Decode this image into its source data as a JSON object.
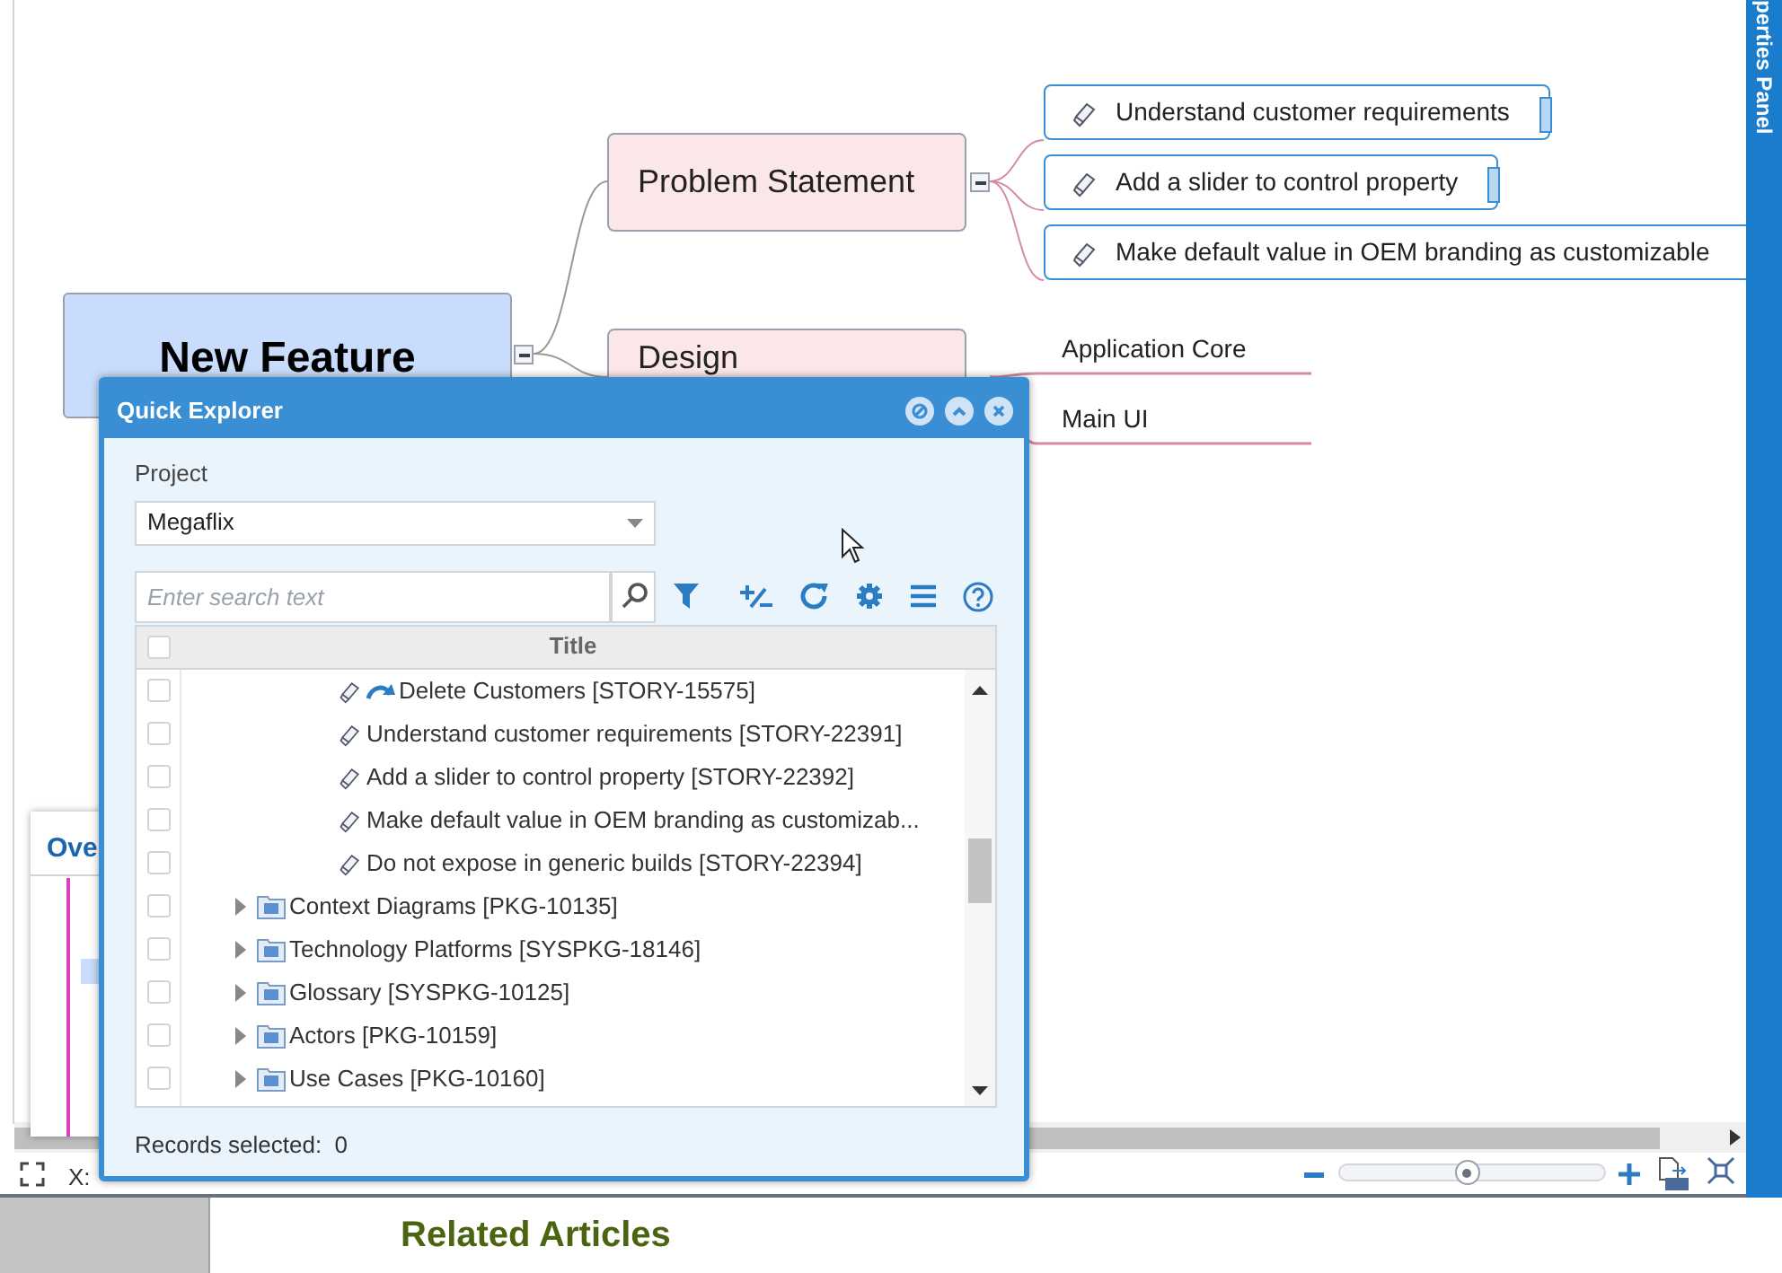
{
  "mind_map": {
    "root": {
      "label": "New Feature",
      "expanded": true
    },
    "branches": [
      {
        "label": "Problem Statement",
        "expanded": true,
        "children": [
          {
            "label": "Understand customer requirements",
            "kind": "story"
          },
          {
            "label": "Add a slider to control property",
            "kind": "story"
          },
          {
            "label": "Make default value in OEM branding as customizable",
            "kind": "story"
          }
        ]
      },
      {
        "label": "Design",
        "children": [
          {
            "label": "Application Core",
            "kind": "topic"
          },
          {
            "label": "Main UI",
            "kind": "topic"
          }
        ]
      }
    ]
  },
  "side_panel": {
    "title": "perties Panel"
  },
  "overview_panel": {
    "title": "Ove"
  },
  "status_bar": {
    "coordinates_label": "X:",
    "zoom": {
      "level": 0.48
    }
  },
  "footer": {
    "heading": "Related Articles"
  },
  "quick_explorer": {
    "title": "Quick Explorer",
    "project_label": "Project",
    "project": "Megaflix",
    "search": {
      "placeholder": "Enter search text"
    },
    "grid": {
      "columns": [
        "Title"
      ],
      "all_checked": false,
      "rows": [
        {
          "kind": "story",
          "title": "Delete Customers [STORY-15575]",
          "linked": true,
          "checked": false
        },
        {
          "kind": "story",
          "title": "Understand customer requirements [STORY-22391]",
          "linked": false,
          "checked": false
        },
        {
          "kind": "story",
          "title": "Add a slider to control property [STORY-22392]",
          "linked": false,
          "checked": false
        },
        {
          "kind": "story",
          "title": "Make default value in OEM branding as customizab...",
          "linked": false,
          "checked": false
        },
        {
          "kind": "story",
          "title": "Do not expose in generic builds [STORY-22394]",
          "linked": false,
          "checked": false
        },
        {
          "kind": "package",
          "title": "Context Diagrams [PKG-10135]",
          "expanded": false,
          "checked": false
        },
        {
          "kind": "package",
          "title": "Technology Platforms [SYSPKG-18146]",
          "expanded": false,
          "checked": false
        },
        {
          "kind": "package",
          "title": "Glossary [SYSPKG-10125]",
          "expanded": false,
          "checked": false
        },
        {
          "kind": "package",
          "title": "Actors [PKG-10159]",
          "expanded": false,
          "checked": false
        },
        {
          "kind": "package",
          "title": "Use Cases [PKG-10160]",
          "expanded": false,
          "checked": false
        }
      ]
    },
    "records_selected": "Records selected:  0"
  }
}
